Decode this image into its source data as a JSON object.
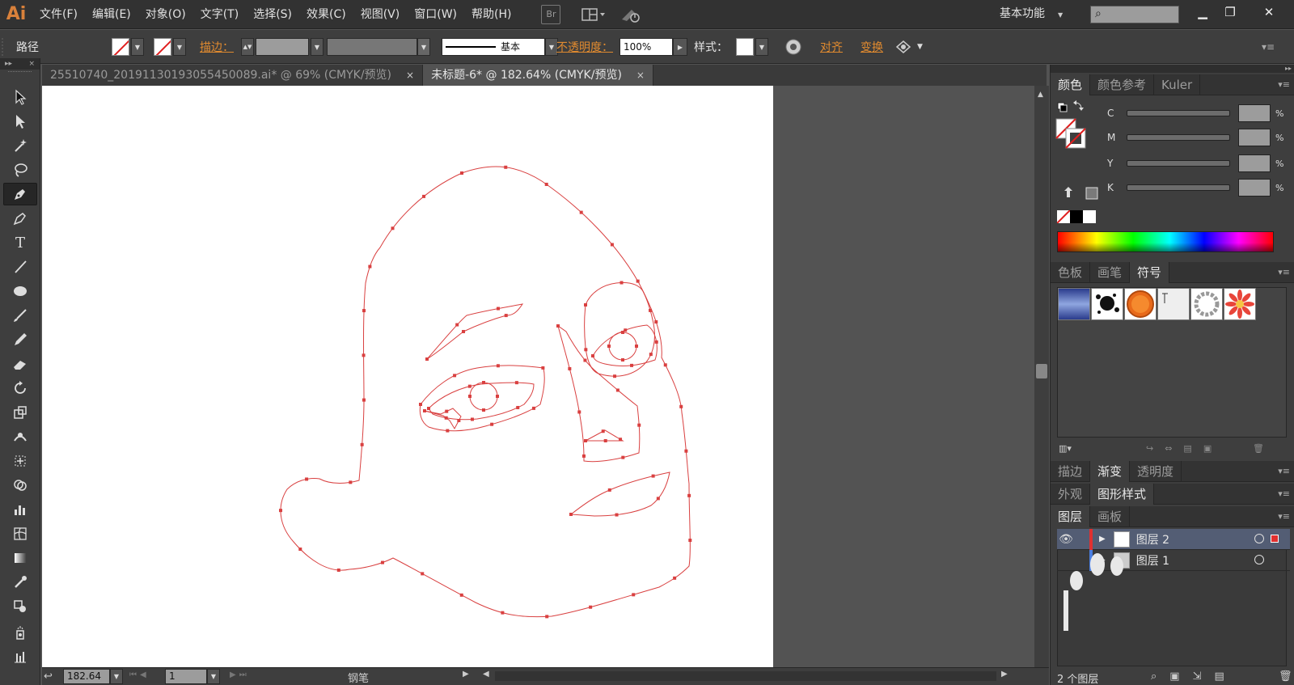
{
  "app": {
    "logo": "Ai"
  },
  "menu": [
    "文件(F)",
    "编辑(E)",
    "对象(O)",
    "文字(T)",
    "选择(S)",
    "效果(C)",
    "视图(V)",
    "窗口(W)",
    "帮助(H)"
  ],
  "menubar_icons": {
    "bridge": "Br"
  },
  "workspace": {
    "label": "基本功能"
  },
  "window_controls": {
    "minimize": "▁",
    "restore": "❐",
    "close": "✕"
  },
  "control": {
    "object_type": "路径",
    "stroke_label": "描边：",
    "stroke_style": "基本",
    "opacity_label": "不透明度：",
    "opacity_value": "100%",
    "style_label": "样式：",
    "align_label": "对齐",
    "transform_label": "变换"
  },
  "tabs": [
    {
      "label": "25510740_20191130193055450089.ai* @ 69% (CMYK/预览)",
      "close": "×"
    },
    {
      "label": "未标题-6* @ 182.64% (CMYK/预览)",
      "close": "×"
    }
  ],
  "toolbar_head": {
    "expand": "▸▸",
    "close": "×"
  },
  "tools": [
    "selection-tool",
    "direct-selection-tool",
    "magic-wand-tool",
    "lasso-tool",
    "pen-tool",
    "curvature-tool",
    "type-tool",
    "line-tool",
    "ellipse-tool",
    "paintbrush-tool",
    "pencil-tool",
    "eraser-tool",
    "rotate-tool",
    "scale-tool",
    "warp-tool",
    "free-transform-tool",
    "shape-builder-tool",
    "graph-tool",
    "mesh-tool",
    "gradient-tool",
    "eyedropper-tool",
    "blend-tool",
    "symbol-sprayer-tool",
    "column-graph-tool"
  ],
  "status": {
    "zoom": "182.64",
    "artboard": "1",
    "tool": "钢笔"
  },
  "color_panel": {
    "tabs": [
      "颜色",
      "颜色参考",
      "Kuler"
    ],
    "channels": [
      {
        "label": "C"
      },
      {
        "label": "M"
      },
      {
        "label": "Y"
      },
      {
        "label": "K"
      }
    ],
    "pct": "%"
  },
  "symbols_panel": {
    "tabs": [
      "色板",
      "画笔",
      "符号"
    ]
  },
  "stroke_gradient_tabs": [
    "描边",
    "渐变",
    "透明度"
  ],
  "appearance_tabs": [
    "外观",
    "图形样式"
  ],
  "layers_panel": {
    "tabs": [
      "图层",
      "画板"
    ],
    "layers": [
      {
        "name": "图层 2",
        "color": "#e03030"
      },
      {
        "name": "图层 1",
        "color": "#4a7ee0"
      }
    ],
    "count": "2 个图层"
  },
  "colors": {
    "accent": "#e08a2f",
    "path": "#d94040",
    "ui_bg": "#535353"
  }
}
